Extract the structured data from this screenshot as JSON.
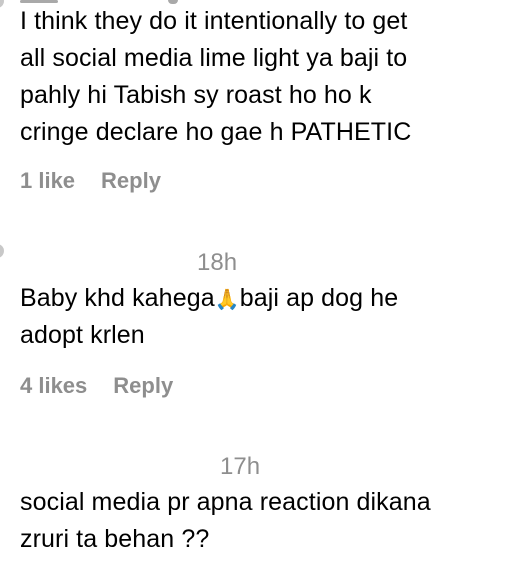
{
  "comments": [
    {
      "text": "I think they do it intentionally to get\nall social media lime light ya baji to\npahly hi Tabish sy roast ho ho k\ncringe declare ho gae h PATHETIC",
      "likes": "1 like",
      "reply": "Reply"
    },
    {
      "timestamp": "18h",
      "text_before_emoji": "Baby khd kahega",
      "emoji": "🙏",
      "text_after_emoji": "baji ap dog he\nadopt krlen",
      "likes": "4 likes",
      "reply": "Reply"
    },
    {
      "timestamp": "17h",
      "text": "social media pr apna reaction dikana\nzruri ta behan ??"
    }
  ],
  "colors": {
    "text": "#000000",
    "meta": "#8e8e8e",
    "background": "#ffffff"
  },
  "icons": {
    "top_fragment": "username-line-fragment",
    "avatar": "avatar-partial"
  }
}
